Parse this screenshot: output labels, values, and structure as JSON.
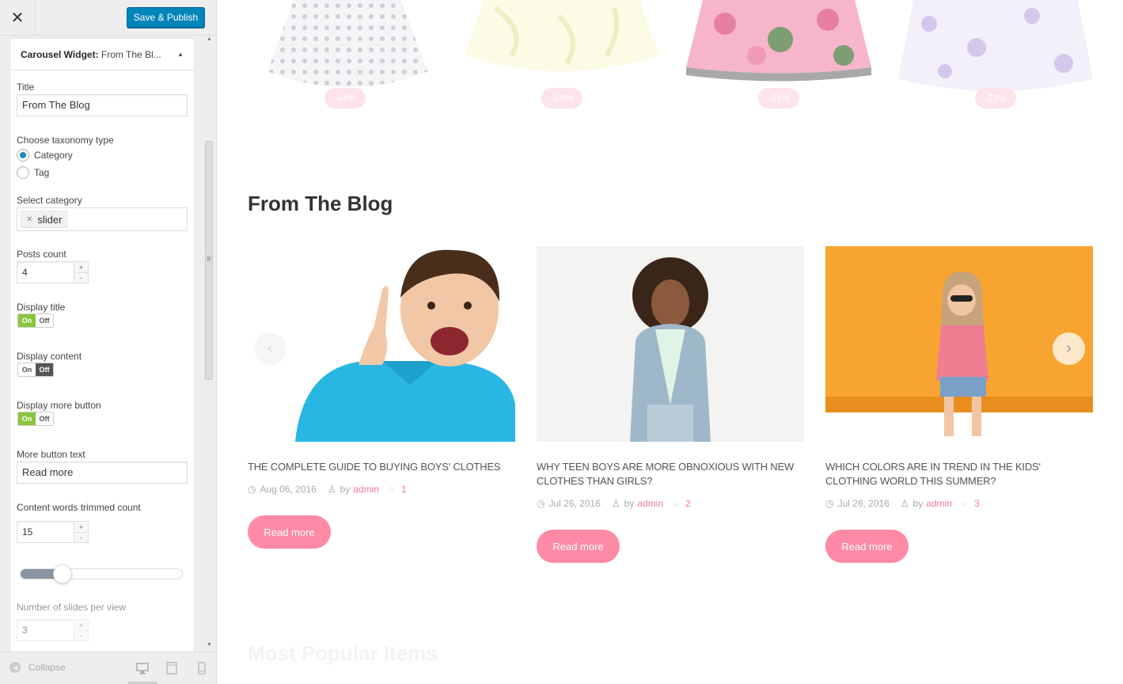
{
  "header": {
    "publish_label": "Save & Publish"
  },
  "widget": {
    "title_bold": "Carousel Widget:",
    "title_rest": "From The Bl...",
    "fields": {
      "title_label": "Title",
      "title_value": "From The Blog",
      "taxonomy_label": "Choose taxonomy type",
      "taxonomy_options": [
        "Category",
        "Tag"
      ],
      "taxonomy_selected": "Category",
      "category_label": "Select category",
      "category_tag": "slider",
      "posts_count_label": "Posts count",
      "posts_count_value": "4",
      "display_title_label": "Display title",
      "display_title": "On",
      "display_content_label": "Display content",
      "display_content": "Off",
      "display_more_label": "Display more button",
      "display_more": "On",
      "toggle_on": "On",
      "toggle_off": "Off",
      "more_text_label": "More button text",
      "more_text_value": "Read more",
      "trimmed_label": "Content words trimmed count",
      "trimmed_value": "15",
      "slider_level": 0.2,
      "slides_label": "Number of slides per view",
      "slides_value": "3"
    }
  },
  "footer": {
    "collapse_label": "Collapse"
  },
  "preview": {
    "discounts": [
      "-44%",
      "-28%",
      "-31%",
      "-23%"
    ],
    "blog_heading": "From The Blog",
    "posts": [
      {
        "title": "THE COMPLETE GUIDE TO BUYING BOYS' CLOTHES",
        "date": "Aug 06, 2016",
        "by": "by",
        "author": "admin",
        "comments": "1",
        "button": "Read more"
      },
      {
        "title": "WHY TEEN BOYS ARE MORE OBNOXIOUS WITH NEW CLOTHES THAN GIRLS?",
        "date": "Jul 26, 2016",
        "by": "by",
        "author": "admin",
        "comments": "2",
        "button": "Read more"
      },
      {
        "title": "WHICH COLORS ARE IN TREND IN THE KIDS' CLOTHING WORLD THIS SUMMER?",
        "date": "Jul 26, 2016",
        "by": "by",
        "author": "admin",
        "comments": "3",
        "button": "Read more"
      }
    ],
    "popular_heading": "Most Popular Items"
  },
  "colors": {
    "primary": "#0085ba",
    "accent_pink": "#ff8aa5",
    "toggle_on": "#8ac53e"
  }
}
